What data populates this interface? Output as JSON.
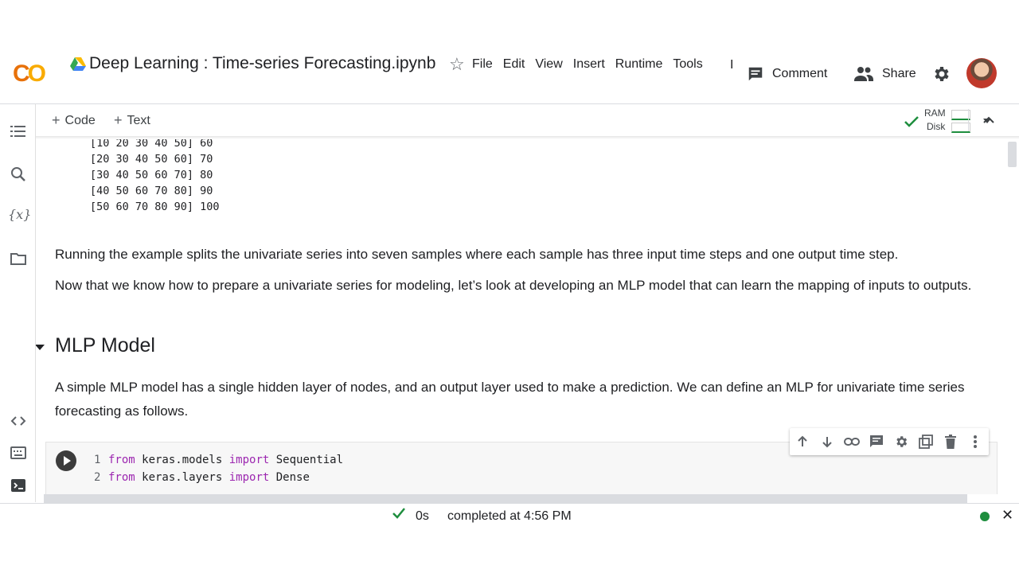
{
  "header": {
    "logo": "CO",
    "title": "Deep Learning : Time-series Forecasting.ipynb",
    "menu": [
      "File",
      "Edit",
      "View",
      "Insert",
      "Runtime",
      "Tools",
      "I"
    ],
    "comment_label": "Comment",
    "share_label": "Share"
  },
  "toolbar": {
    "code_label": "Code",
    "text_label": "Text",
    "ram_label": "RAM",
    "disk_label": "Disk"
  },
  "output": {
    "lines": [
      "[10 20 30 40 50] 60",
      "[20 30 40 50 60] 70",
      "[30 40 50 60 70] 80",
      "[40 50 60 70 80] 90",
      "[50 60 70 80 90] 100"
    ]
  },
  "text": {
    "para1": "Running the example splits the univariate series into seven samples where each sample has three input time steps and one output time step.",
    "para2": "Now that we know how to prepare a univariate series for modeling, let’s look at developing an MLP model that can learn the mapping of inputs to outputs.",
    "section_title": "MLP Model",
    "para3": "A simple MLP model has a single hidden layer of nodes, and an output layer used to make a prediction. We can define an MLP for univariate time series forecasting as follows."
  },
  "code": {
    "lines": [
      {
        "num": "1",
        "kw1": "from",
        "mod": " keras.models ",
        "kw2": "import",
        "name": " Sequential"
      },
      {
        "num": "2",
        "kw1": "from",
        "mod": " keras.layers ",
        "kw2": "import",
        "name": " Dense"
      }
    ]
  },
  "status": {
    "time": "0s",
    "text": "completed at 4:56 PM"
  },
  "colors": {
    "accent_green": "#1e8e3e",
    "keyword_purple": "#9c27b0",
    "logo_orange": "#e8710a",
    "logo_yellow": "#f9ab00"
  }
}
